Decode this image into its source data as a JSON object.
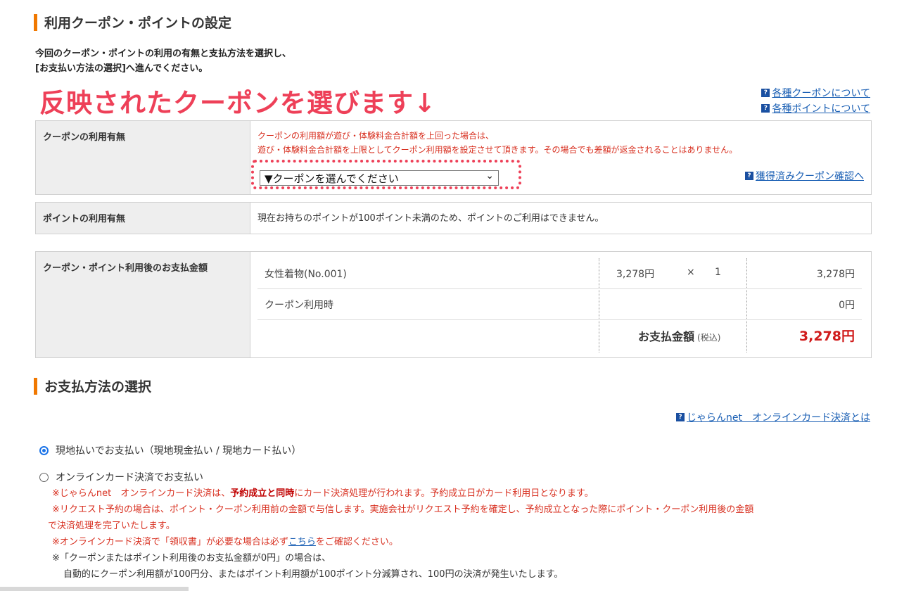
{
  "section1": {
    "title": "利用クーポン・ポイントの設定"
  },
  "intro": {
    "line1": "今回のクーポン・ポイントの利用の有無と支払方法を選択し、",
    "line2": "[お支払い方法の選択]へ進んでください。"
  },
  "annotation": {
    "text": "反映されたクーポンを選びます↓"
  },
  "help_links": {
    "coupon_about": "各種クーポンについて",
    "point_about": "各種ポイントについて",
    "coupon_check": "獲得済みクーポン確認へ",
    "online_card_about": "じゃらんnet　オンラインカード決済とは"
  },
  "coupon_panel": {
    "label": "クーポンの利用有無",
    "note1": "クーポンの利用額が遊び・体験料金合計額を上回った場合は、",
    "note2": "遊び・体験料金合計額を上限としてクーポン利用額を設定させて頂きます。その場合でも差額が返金されることはありません。",
    "select_value": "▼クーポンを選んでください",
    "select_arrow": "⌄"
  },
  "point_panel": {
    "label": "ポイントの利用有無",
    "text": "現在お持ちのポイントが100ポイント未満のため、ポイントのご利用はできません。"
  },
  "payment_panel": {
    "label": "クーポン・ポイント利用後のお支払金額",
    "rows": [
      {
        "name": "女性着物(No.001)",
        "unit_price": "3,278円",
        "times": "×",
        "qty": "1",
        "amount": "3,278円"
      },
      {
        "name": "クーポン利用時",
        "unit_price": "",
        "times": "",
        "qty": "",
        "amount": "0円"
      }
    ],
    "total_label": "お支払金額",
    "total_tax": "(税込)",
    "total_value": "3,278円"
  },
  "section2": {
    "title": "お支払方法の選択"
  },
  "payment_options": [
    {
      "label": "現地払いでお支払い（現地現金払い / 現地カード払い）",
      "selected": true
    },
    {
      "label": "オンラインカード決済でお支払い",
      "selected": false
    }
  ],
  "notes": {
    "n1_pre": "※じゃらんnet　オンラインカード決済は、",
    "n1_bold": "予約成立と同時",
    "n1_post": "にカード決済処理が行われます。予約成立日がカード利用日となります。",
    "n2a": "※リクエスト予約の場合は、ポイント・クーポン利用前の金額で与信します。実施会社がリクエスト予約を確定し、予約成立となった際にポイント・クーポン利用後の金額",
    "n2b": "で決済処理を完了いたします。",
    "n3_pre": "※オンラインカード決済で「領収書」が必要な場合は必ず",
    "n3_link": "こちら",
    "n3_post": "をご確認ください。",
    "n4a": "※「クーポンまたはポイント利用後のお支払金額が0円」の場合は、",
    "n4b": "自動的にクーポン利用額が100円分、またはポイント利用額が100ポイント分減算され、100円の決済が発生いたします。"
  },
  "colors": {
    "accent": "#f07800",
    "annotation": "#ee4058",
    "warning": "#d83020",
    "link": "#1a5fb4"
  }
}
